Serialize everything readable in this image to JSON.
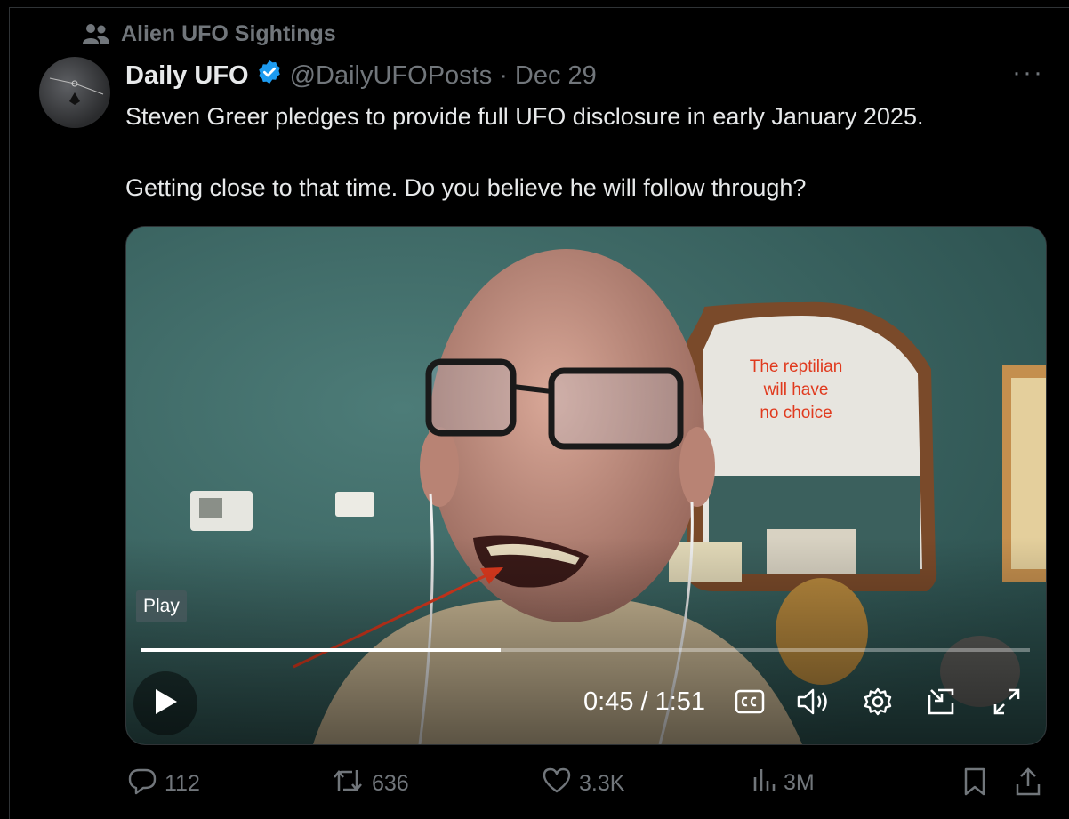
{
  "context": {
    "community": "Alien UFO Sightings",
    "icon": "people-icon"
  },
  "author": {
    "name": "Daily UFO",
    "verified": true,
    "handle": "@DailyUFOPosts",
    "separator": "·",
    "date": "Dec 29"
  },
  "more_label": "···",
  "post": {
    "line1": "Steven Greer pledges to provide full UFO disclosure in early January 2025.",
    "line2": "Getting close to that time. Do you believe he will follow through?"
  },
  "video": {
    "annotation_line1": "The reptilian",
    "annotation_line2": "will have",
    "annotation_line3": "no choice",
    "tooltip": "Play",
    "time": "0:45 / 1:51",
    "progress_fraction": 0.405,
    "accent_annotation": "#e03a1e"
  },
  "actions": {
    "replies": "112",
    "reposts": "636",
    "likes": "3.3K",
    "views": "3M"
  },
  "colors": {
    "background": "#000000",
    "muted": "#71767b",
    "verified": "#1d9bf0",
    "text": "#e7e9ea"
  }
}
